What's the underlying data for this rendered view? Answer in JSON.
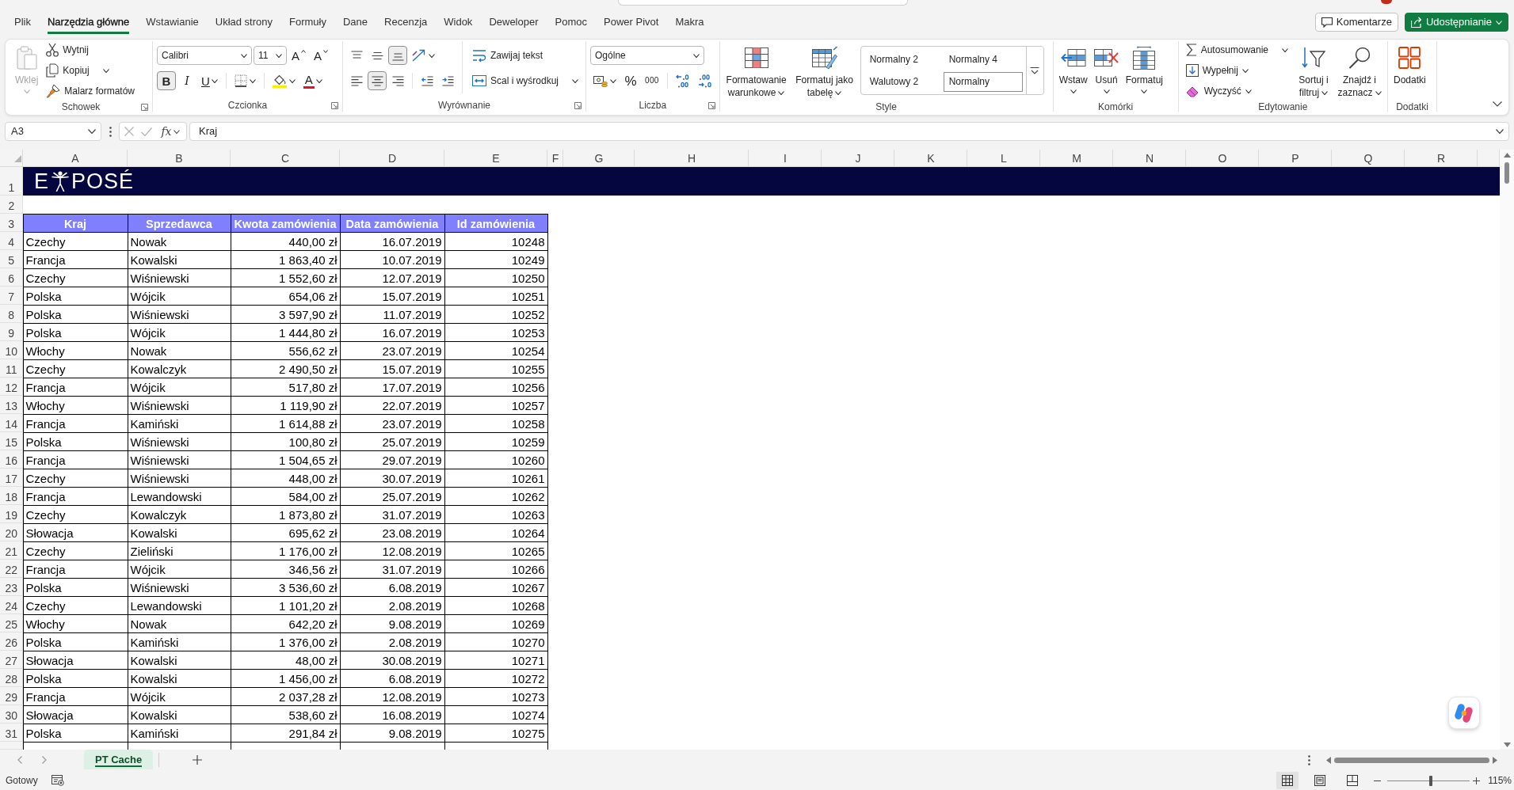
{
  "menu_tabs": [
    {
      "label": "Plik",
      "selected": false
    },
    {
      "label": "Narzędzia główne",
      "selected": true
    },
    {
      "label": "Wstawianie",
      "selected": false
    },
    {
      "label": "Układ strony",
      "selected": false
    },
    {
      "label": "Formuły",
      "selected": false
    },
    {
      "label": "Dane",
      "selected": false
    },
    {
      "label": "Recenzja",
      "selected": false
    },
    {
      "label": "Widok",
      "selected": false
    },
    {
      "label": "Deweloper",
      "selected": false
    },
    {
      "label": "Pomoc",
      "selected": false
    },
    {
      "label": "Power Pivot",
      "selected": false
    },
    {
      "label": "Makra",
      "selected": false
    }
  ],
  "header_buttons": [
    {
      "label": "Komentarze",
      "kind": "outline",
      "dropdown": false
    },
    {
      "label": "Udostępnianie",
      "kind": "primary",
      "dropdown": true
    }
  ],
  "ribbon": [
    {
      "label": "Schowek",
      "launcher": true,
      "sections": [
        {
          "kind": "large",
          "label": "Wklej",
          "disabled": true,
          "dropdown": true
        },
        {
          "kind": "stack",
          "lines": [
            {
              "controls": [
                {
                  "kind": "small",
                  "label": "Wytnij"
                }
              ]
            },
            {
              "controls": [
                {
                  "kind": "small",
                  "label": "Kopiuj",
                  "dropdown": true
                }
              ]
            },
            {
              "controls": [
                {
                  "kind": "small",
                  "label": "Malarz formatów"
                }
              ]
            }
          ]
        }
      ]
    },
    {
      "label": "Czcionka",
      "launcher": true,
      "sections": [
        {
          "kind": "stack",
          "lines": [
            {
              "controls": [
                {
                  "kind": "combo",
                  "value": "Calibri"
                },
                {
                  "kind": "combo",
                  "value": "11"
                },
                {
                  "kind": "glyph",
                  "label": "A"
                },
                {
                  "kind": "glyph",
                  "label": "A"
                }
              ]
            },
            {
              "controls": [
                {
                  "kind": "glyph",
                  "label": "B",
                  "selected": true
                },
                {
                  "kind": "glyph",
                  "label": "I",
                  "selected": false
                },
                {
                  "kind": "glyph",
                  "label": "U",
                  "selected": false,
                  "dropdown": true
                },
                {
                  "kind": "icon",
                  "dropdown": true
                },
                {
                  "kind": "icon",
                  "dropdown": true
                },
                {
                  "kind": "glyph",
                  "label": "A",
                  "dropdown": true
                }
              ]
            }
          ]
        }
      ]
    },
    {
      "label": "Wyrównanie",
      "launcher": true,
      "sections": [
        {
          "kind": "stack",
          "lines": [
            {
              "controls": [
                {
                  "kind": "icon",
                  "selected": false
                },
                {
                  "kind": "icon",
                  "selected": false
                },
                {
                  "kind": "icon",
                  "selected": true
                },
                {
                  "kind": "icon",
                  "dropdown": true
                }
              ]
            },
            {
              "controls": [
                {
                  "kind": "icon",
                  "selected": false
                },
                {
                  "kind": "icon",
                  "selected": true
                },
                {
                  "kind": "icon",
                  "selected": false
                },
                {
                  "kind": "icon"
                },
                {
                  "kind": "icon"
                }
              ]
            }
          ]
        },
        {
          "kind": "stack",
          "lines": [
            {
              "controls": [
                {
                  "kind": "small",
                  "label": "Zawijaj tekst"
                }
              ]
            },
            {
              "controls": [
                {
                  "kind": "small",
                  "label": "Scal i wyśrodkuj",
                  "dropdown": true
                }
              ]
            }
          ]
        }
      ]
    },
    {
      "label": "Liczba",
      "launcher": true,
      "sections": [
        {
          "kind": "stack",
          "lines": [
            {
              "controls": [
                {
                  "kind": "combo",
                  "value": "Ogólne"
                }
              ]
            },
            {
              "controls": [
                {
                  "kind": "icon",
                  "dropdown": true
                },
                {
                  "kind": "glyph",
                  "label": "%"
                },
                {
                  "kind": "glyph",
                  "label": "000"
                },
                {
                  "kind": "icon"
                },
                {
                  "kind": "icon"
                }
              ]
            }
          ]
        }
      ]
    },
    {
      "label": "Style",
      "launcher": false,
      "sections": [
        {
          "kind": "large",
          "label": "Formatowanie warunkowe",
          "dropdown": true
        },
        {
          "kind": "large",
          "label": "Formatuj jako tabelę",
          "dropdown": true
        },
        {
          "kind": "gallery",
          "items": [
            {
              "label": "Normalny 2",
              "selected": false
            },
            {
              "label": "Normalny 4",
              "selected": false
            },
            {
              "label": "Walutowy 2",
              "selected": false
            },
            {
              "label": "Normalny",
              "selected": true
            }
          ]
        }
      ]
    },
    {
      "label": "Komórki",
      "launcher": false,
      "sections": [
        {
          "kind": "large",
          "label": "Wstaw",
          "dropdown": true
        },
        {
          "kind": "large",
          "label": "Usuń",
          "dropdown": true
        },
        {
          "kind": "large",
          "label": "Formatuj",
          "dropdown": true
        }
      ]
    },
    {
      "label": "Edytowanie",
      "launcher": false,
      "sections": [
        {
          "kind": "stack",
          "lines": [
            {
              "controls": [
                {
                  "kind": "small",
                  "label": "Autosumowanie",
                  "dropdown": true
                }
              ]
            },
            {
              "controls": [
                {
                  "kind": "small",
                  "label": "Wypełnij",
                  "dropdown": true
                }
              ]
            },
            {
              "controls": [
                {
                  "kind": "small",
                  "label": "Wyczyść",
                  "dropdown": true
                }
              ]
            }
          ]
        },
        {
          "kind": "large",
          "label": "Sortuj i filtruj",
          "dropdown": true
        },
        {
          "kind": "large",
          "label": "Znajdź i zaznacz",
          "dropdown": true
        }
      ]
    },
    {
      "label": "Dodatki",
      "launcher": false,
      "sections": [
        {
          "kind": "large",
          "label": "Dodatki"
        }
      ]
    }
  ],
  "formula_bar": {
    "name_box": "A3",
    "function_label": "fx",
    "formula": "Kraj"
  },
  "sheet": {
    "column_headers": [
      "A",
      "B",
      "C",
      "D",
      "E",
      "F",
      "G",
      "H",
      "I",
      "J",
      "K",
      "L",
      "M",
      "N",
      "O",
      "P",
      "Q",
      "R"
    ],
    "row_headers": [
      "1",
      "2",
      "3",
      "4",
      "5",
      "6",
      "7",
      "8",
      "9",
      "10",
      "11",
      "12",
      "13",
      "14",
      "15",
      "16",
      "17",
      "18",
      "19",
      "20",
      "21",
      "22",
      "23",
      "24",
      "25",
      "26",
      "27",
      "28",
      "29",
      "30",
      "31"
    ],
    "logo": {
      "text_left": "E",
      "text_right": "POSÉ"
    },
    "table": {
      "columns": [
        {
          "label": "Kraj",
          "kind": "text"
        },
        {
          "label": "Sprzedawca",
          "kind": "text"
        },
        {
          "label": "Kwota zamówienia",
          "kind": "number"
        },
        {
          "label": "Data zamówienia",
          "kind": "number"
        },
        {
          "label": "Id zamówienia",
          "kind": "number"
        }
      ],
      "rows": [
        [
          "Czechy",
          "Nowak",
          "440,00 zł",
          "16.07.2019",
          "10248"
        ],
        [
          "Francja",
          "Kowalski",
          "1 863,40 zł",
          "10.07.2019",
          "10249"
        ],
        [
          "Czechy",
          "Wiśniewski",
          "1 552,60 zł",
          "12.07.2019",
          "10250"
        ],
        [
          "Polska",
          "Wójcik",
          "654,06 zł",
          "15.07.2019",
          "10251"
        ],
        [
          "Polska",
          "Wiśniewski",
          "3 597,90 zł",
          "11.07.2019",
          "10252"
        ],
        [
          "Polska",
          "Wójcik",
          "1 444,80 zł",
          "16.07.2019",
          "10253"
        ],
        [
          "Włochy",
          "Nowak",
          "556,62 zł",
          "23.07.2019",
          "10254"
        ],
        [
          "Czechy",
          "Kowalczyk",
          "2 490,50 zł",
          "15.07.2019",
          "10255"
        ],
        [
          "Francja",
          "Wójcik",
          "517,80 zł",
          "17.07.2019",
          "10256"
        ],
        [
          "Włochy",
          "Wiśniewski",
          "1 119,90 zł",
          "22.07.2019",
          "10257"
        ],
        [
          "Francja",
          "Kamiński",
          "1 614,88 zł",
          "23.07.2019",
          "10258"
        ],
        [
          "Polska",
          "Wiśniewski",
          "100,80 zł",
          "25.07.2019",
          "10259"
        ],
        [
          "Francja",
          "Wiśniewski",
          "1 504,65 zł",
          "29.07.2019",
          "10260"
        ],
        [
          "Czechy",
          "Wiśniewski",
          "448,00 zł",
          "30.07.2019",
          "10261"
        ],
        [
          "Francja",
          "Lewandowski",
          "584,00 zł",
          "25.07.2019",
          "10262"
        ],
        [
          "Czechy",
          "Kowalczyk",
          "1 873,80 zł",
          "31.07.2019",
          "10263"
        ],
        [
          "Słowacja",
          "Kowalski",
          "695,62 zł",
          "23.08.2019",
          "10264"
        ],
        [
          "Czechy",
          "Zieliński",
          "1 176,00 zł",
          "12.08.2019",
          "10265"
        ],
        [
          "Francja",
          "Wójcik",
          "346,56 zł",
          "31.07.2019",
          "10266"
        ],
        [
          "Polska",
          "Wiśniewski",
          "3 536,60 zł",
          "6.08.2019",
          "10267"
        ],
        [
          "Czechy",
          "Lewandowski",
          "1 101,20 zł",
          "2.08.2019",
          "10268"
        ],
        [
          "Włochy",
          "Nowak",
          "642,20 zł",
          "9.08.2019",
          "10269"
        ],
        [
          "Polska",
          "Kamiński",
          "1 376,00 zł",
          "2.08.2019",
          "10270"
        ],
        [
          "Słowacja",
          "Kowalski",
          "48,00 zł",
          "30.08.2019",
          "10271"
        ],
        [
          "Polska",
          "Kowalski",
          "1 456,00 zł",
          "6.08.2019",
          "10272"
        ],
        [
          "Francja",
          "Wójcik",
          "2 037,28 zł",
          "12.08.2019",
          "10273"
        ],
        [
          "Słowacja",
          "Kowalski",
          "538,60 zł",
          "16.08.2019",
          "10274"
        ],
        [
          "Polska",
          "Kamiński",
          "291,84 zł",
          "9.08.2019",
          "10275"
        ]
      ]
    }
  },
  "sheet_tabs": [
    {
      "label": "PT Cache",
      "selected": true
    }
  ],
  "status_bar": {
    "status": "Gotowy",
    "views": [
      {
        "selected": true
      },
      {
        "selected": false
      },
      {
        "selected": false
      }
    ],
    "zoom": {
      "level": 0.53,
      "reading": "115%"
    }
  }
}
